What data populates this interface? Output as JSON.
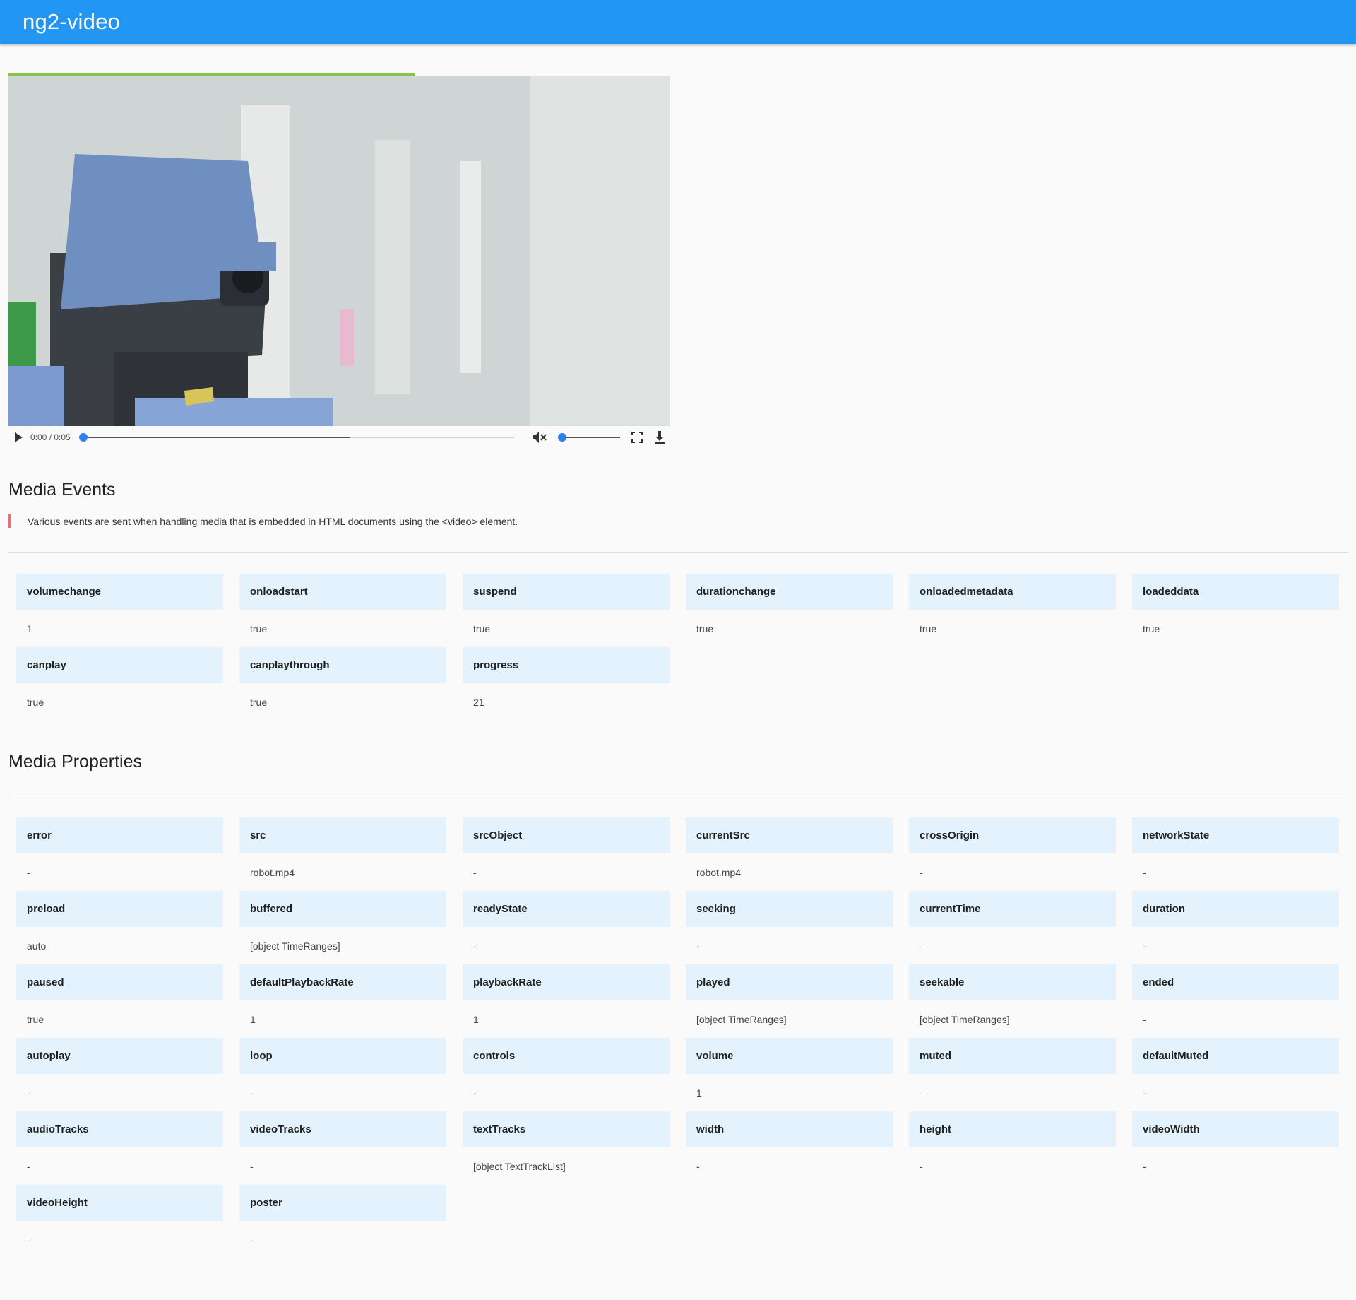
{
  "app": {
    "title": "ng2-video"
  },
  "player": {
    "time_display": "0:00 / 0:05",
    "seek_fraction": 0,
    "buffered_fraction": 0.62,
    "volume_fraction": 0,
    "icons": [
      "play-icon",
      "mute-icon",
      "fullscreen-icon",
      "download-icon"
    ]
  },
  "events": {
    "title": "Media Events",
    "description": "Various events are sent when handling media that is embedded in HTML documents using the <video> element.",
    "items": [
      {
        "key": "volumechange",
        "value": "1"
      },
      {
        "key": "onloadstart",
        "value": "true"
      },
      {
        "key": "suspend",
        "value": "true"
      },
      {
        "key": "durationchange",
        "value": "true"
      },
      {
        "key": "onloadedmetadata",
        "value": "true"
      },
      {
        "key": "loadeddata",
        "value": "true"
      },
      {
        "key": "canplay",
        "value": "true"
      },
      {
        "key": "canplaythrough",
        "value": "true"
      },
      {
        "key": "progress",
        "value": "21"
      }
    ]
  },
  "properties": {
    "title": "Media Properties",
    "items": [
      {
        "key": "error",
        "value": "-"
      },
      {
        "key": "src",
        "value": "robot.mp4"
      },
      {
        "key": "srcObject",
        "value": "-"
      },
      {
        "key": "currentSrc",
        "value": "robot.mp4"
      },
      {
        "key": "crossOrigin",
        "value": "-"
      },
      {
        "key": "networkState",
        "value": "-"
      },
      {
        "key": "preload",
        "value": "auto"
      },
      {
        "key": "buffered",
        "value": "[object TimeRanges]"
      },
      {
        "key": "readyState",
        "value": "-"
      },
      {
        "key": "seeking",
        "value": "-"
      },
      {
        "key": "currentTime",
        "value": "-"
      },
      {
        "key": "duration",
        "value": "-"
      },
      {
        "key": "paused",
        "value": "true"
      },
      {
        "key": "defaultPlaybackRate",
        "value": "1"
      },
      {
        "key": "playbackRate",
        "value": "1"
      },
      {
        "key": "played",
        "value": "[object TimeRanges]"
      },
      {
        "key": "seekable",
        "value": "[object TimeRanges]"
      },
      {
        "key": "ended",
        "value": "-"
      },
      {
        "key": "autoplay",
        "value": "-"
      },
      {
        "key": "loop",
        "value": "-"
      },
      {
        "key": "controls",
        "value": "-"
      },
      {
        "key": "volume",
        "value": "1"
      },
      {
        "key": "muted",
        "value": "-"
      },
      {
        "key": "defaultMuted",
        "value": "-"
      },
      {
        "key": "audioTracks",
        "value": "-"
      },
      {
        "key": "videoTracks",
        "value": "-"
      },
      {
        "key": "textTracks",
        "value": "[object TextTrackList]"
      },
      {
        "key": "width",
        "value": "-"
      },
      {
        "key": "height",
        "value": "-"
      },
      {
        "key": "videoWidth",
        "value": "-"
      },
      {
        "key": "videoHeight",
        "value": "-"
      },
      {
        "key": "poster",
        "value": "-"
      }
    ]
  },
  "colors": {
    "app_bar": "#2196f3",
    "accent_progress": "#8bc34a",
    "cell_key_bg": "#e3f2fd",
    "quote_border": "#e57373"
  }
}
